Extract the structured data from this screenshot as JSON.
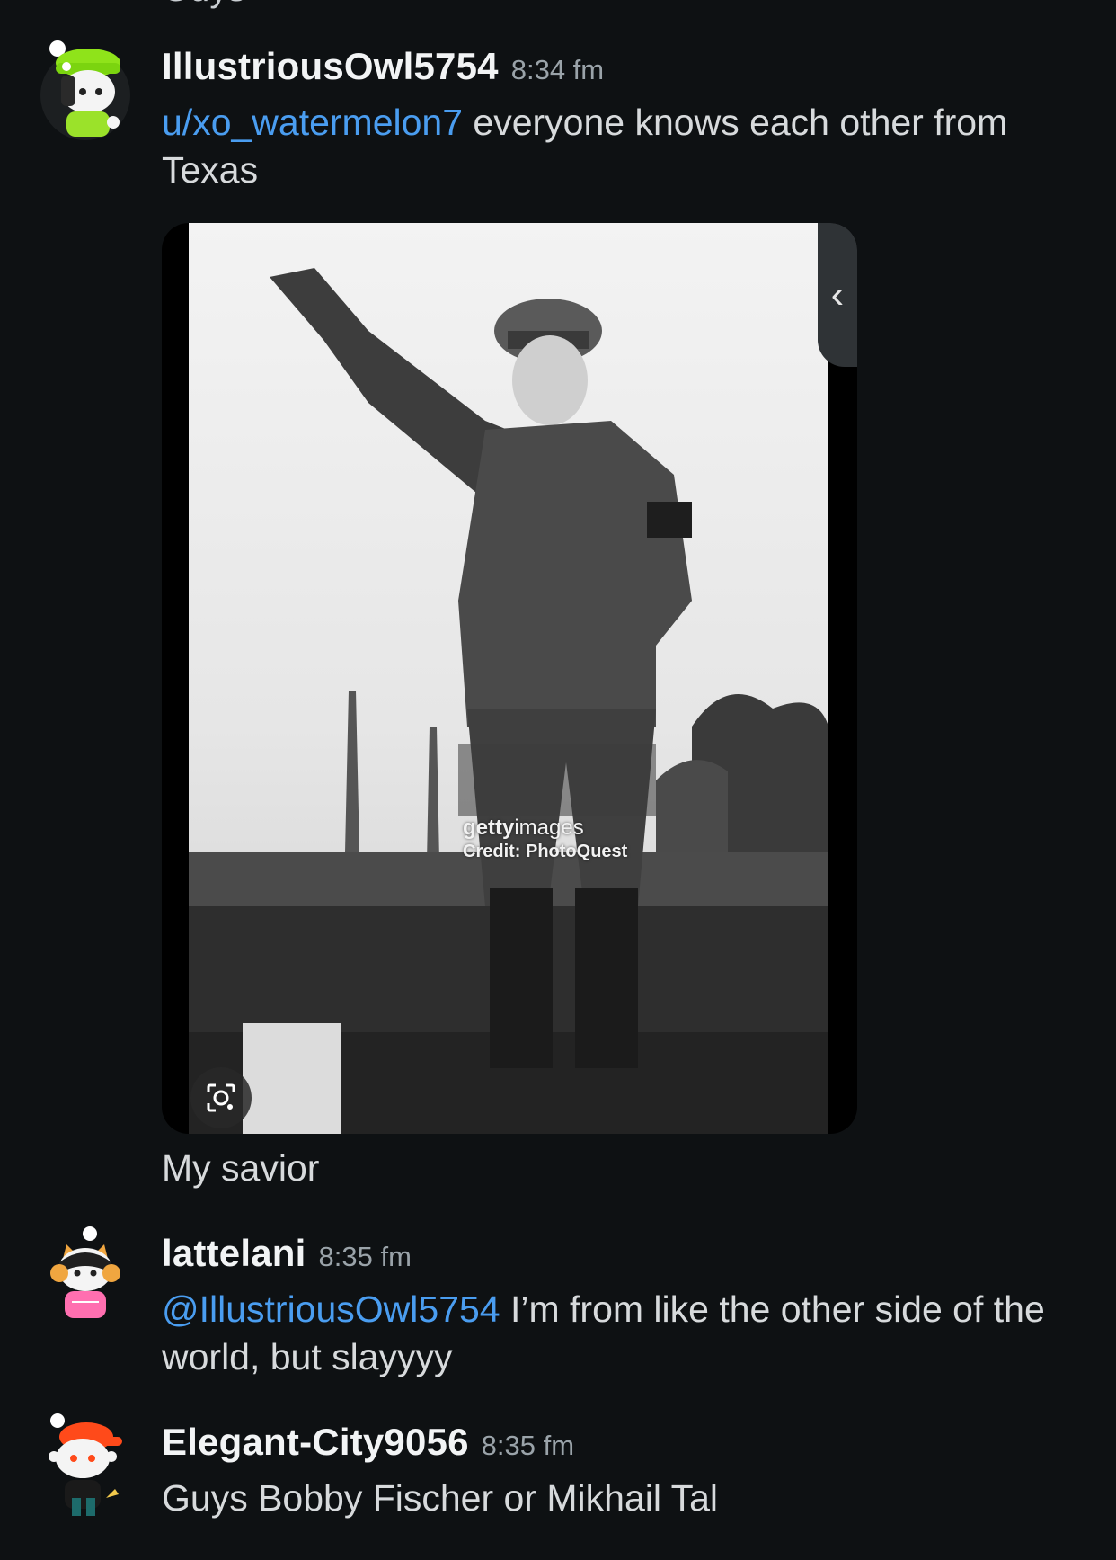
{
  "partial_previous_text": "Guys",
  "messages": [
    {
      "username": "IllustriousOwl5754",
      "time": "8:34 fm",
      "mention": "u/xo_watermelon7",
      "text": " everyone knows each other from Texas",
      "avatar_icon": "snoo-avatar-green-hat",
      "image": {
        "watermark_brand_bold": "getty",
        "watermark_brand_light": "images",
        "watermark_credit": "Credit: PhotoQuest",
        "side_tab_glyph": "‹"
      },
      "caption": "My savior"
    },
    {
      "username": "lattelani",
      "time": "8:35 fm",
      "mention": "@IllustriousOwl5754",
      "text": " I’m from like the other side of the world, but slayyyy",
      "avatar_icon": "snoo-avatar-cat-headset"
    },
    {
      "username": "Elegant-City9056",
      "time": "8:35 fm",
      "text": "Guys Bobby Fischer or Mikhail Tal",
      "avatar_icon": "snoo-avatar-orange-cap"
    }
  ],
  "colors": {
    "background": "#0e1113",
    "mention": "#4a9df0",
    "username": "#f2f4f5",
    "timestamp": "#9aa3a9"
  }
}
